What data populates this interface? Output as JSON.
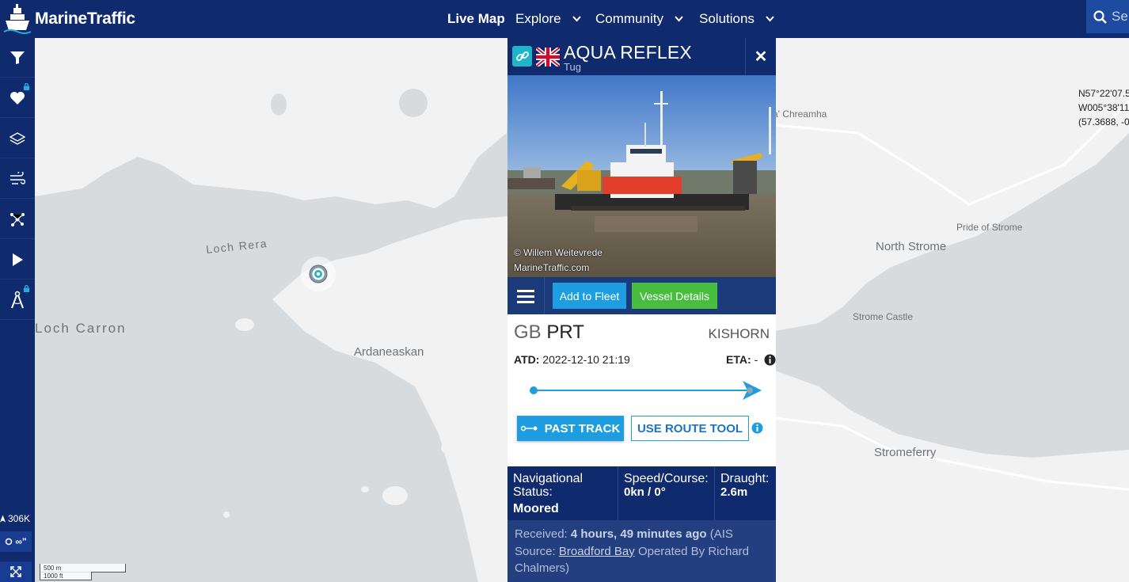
{
  "header": {
    "brand": "MarineTraffic",
    "nav": [
      {
        "label": "Live Map",
        "has_dropdown": false
      },
      {
        "label": "Explore",
        "has_dropdown": true
      },
      {
        "label": "Community",
        "has_dropdown": true
      },
      {
        "label": "Solutions",
        "has_dropdown": true
      }
    ],
    "search_placeholder": "Se"
  },
  "sidebar": {
    "buttons": [
      "filter-icon",
      "heart-icon",
      "layers-icon",
      "weather-icon",
      "network-icon",
      "play-icon",
      "measure-icon"
    ],
    "vessel_count": "306K",
    "density_label": "∞\"",
    "fullscreen_icon": "expand-icon"
  },
  "map": {
    "labels": {
      "loch_reraig": "Loch Rera",
      "loch_carron": "Loch Carron",
      "ardaneaskan": "Ardaneaskan",
      "chreamha": "a' Chreamha",
      "north_strome": "North Strome",
      "pride_of_strome": "Pride of Strome",
      "strome_castle": "Strome Castle",
      "stromeferry": "Stromeferry"
    },
    "scale": {
      "metric": "500 m",
      "imperial": "1000 ft"
    },
    "coords": {
      "lat": "N57°22'07.5",
      "lon": "W005°38'11",
      "decimal": "(57.3688, -0"
    }
  },
  "vessel_panel": {
    "name": "AQUA REFLEX",
    "type": "Tug",
    "flag": "GB",
    "photo_credit_1": "© Willem Weitevrede",
    "photo_credit_2": "MarineTraffic.com",
    "add_to_fleet": "Add to Fleet",
    "vessel_details": "Vessel Details",
    "from_country": "GB",
    "from_port": "PRT",
    "to_port": "KISHORN",
    "atd_label": "ATD:",
    "atd_value": "2022-12-10 21:19",
    "eta_label": "ETA:",
    "eta_value": "-",
    "past_track": "PAST TRACK",
    "use_route_tool": "USE ROUTE TOOL",
    "nav_status_label": "Navigational Status:",
    "nav_status_value": "Moored",
    "speed_label": "Speed/Course:",
    "speed_value": "0kn / 0°",
    "draught_label": "Draught:",
    "draught_value": "2.6m",
    "received_label": "Received:",
    "received_value": "4 hours, 49 minutes ago",
    "ais_prefix": "(AIS Source:",
    "ais_source": "Broadford Bay",
    "ais_suffix": "Operated By Richard Chalmers)"
  },
  "colors": {
    "navy": "#0f2b6e",
    "accent_blue": "#1e9ee0",
    "green": "#49bd3f",
    "teal": "#1fb4c9"
  }
}
